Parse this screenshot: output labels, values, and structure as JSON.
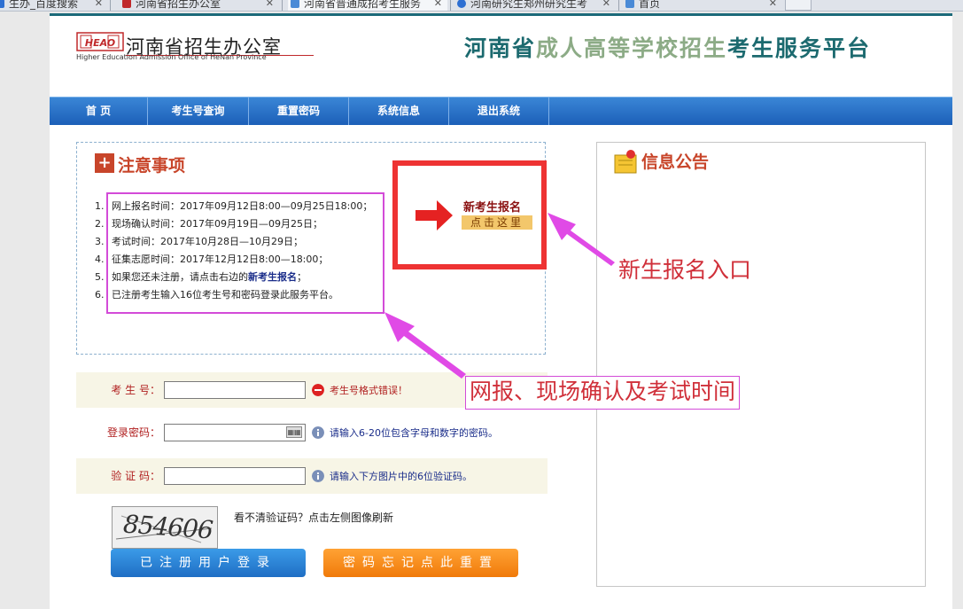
{
  "browser": {
    "tabs": [
      {
        "label": "生办_百度搜索",
        "color": "#2d6fd2"
      },
      {
        "label": "河南省招生办公室",
        "color": "#c0282a"
      },
      {
        "label": "河南省普通成招考生服务",
        "color": "#4a8ad6"
      },
      {
        "label": "河南研究生郑州研究生考",
        "color": "#2d6fd2"
      },
      {
        "label": "首页",
        "color": "#4a8ad6"
      }
    ]
  },
  "header": {
    "logo_mark": "HEAO",
    "logo_cn": "河南省招生办公室",
    "logo_en": "Higher Education Admission Office of HeNan Province",
    "platform_part1": "河南省",
    "platform_part2": "成人高等学校招生",
    "platform_part3": "考生服务平台"
  },
  "nav": {
    "items": [
      "首 页",
      "考生号查询",
      "重置密码",
      "系统信息",
      "退出系统"
    ]
  },
  "notice": {
    "title": "注意事项",
    "items": [
      {
        "num": "1.",
        "text": "网上报名时间：2017年09月12日8:00—09月25日18:00；"
      },
      {
        "num": "2.",
        "text": "现场确认时间：2017年09月19日—09月25日；"
      },
      {
        "num": "3.",
        "text": "考试时间：2017年10月28日—10月29日；"
      },
      {
        "num": "4.",
        "text": "征集志愿时间：2017年12月12日8:00—18:00；"
      },
      {
        "num": "5.",
        "text_before": "如果您还未注册，请点击右边的",
        "text_bold": "新考生报名",
        "text_after": "；"
      },
      {
        "num": "6.",
        "text": "已注册考生输入16位考生号和密码登录此服务平台。"
      }
    ],
    "register_title": "新考生报名",
    "register_button": "点击这里"
  },
  "info": {
    "title": "信息公告"
  },
  "form": {
    "exam_no_label": "考 生 号：",
    "exam_no_value": "",
    "exam_no_error": "考生号格式错误！",
    "password_label": "登录密码：",
    "password_value": "",
    "password_hint": "请输入6-20位包含字母和数字的密码。",
    "captcha_label": "验 证 码：",
    "captcha_value": "",
    "captcha_hint": "请输入下方图片中的6位验证码。",
    "captcha_image_text": "854606",
    "captcha_refresh_hint": "看不清验证码？点击左侧图像刷新",
    "login_button": "已注册用户登录",
    "reset_button": "密码忘记点此重置"
  },
  "annotations": {
    "register_entry": "新生报名入口",
    "schedule": "网报、现场确认及考试时间",
    "color": "#d34bd8"
  }
}
